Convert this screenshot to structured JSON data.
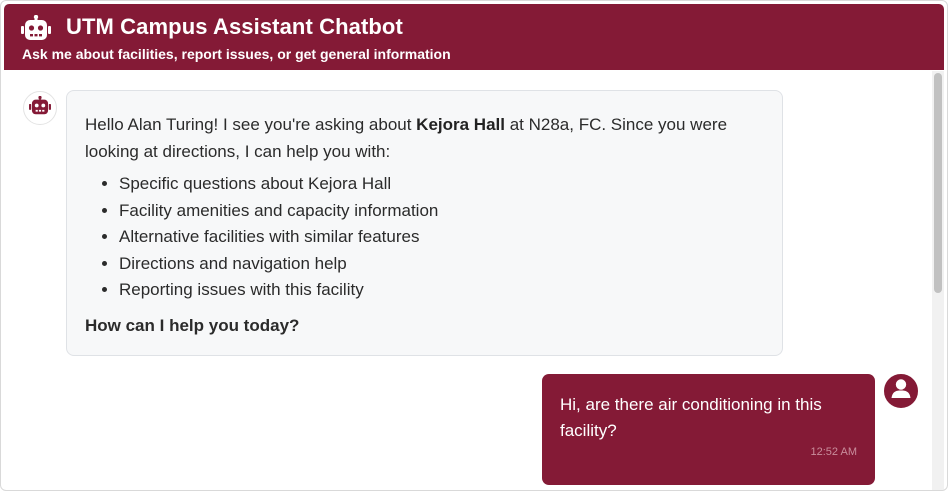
{
  "header": {
    "title": "UTM Campus Assistant Chatbot",
    "subtitle": "Ask me about facilities, report issues, or get general information",
    "icon": "robot-icon"
  },
  "colors": {
    "brand": "#841a36",
    "bot_bubble_bg": "#f7f8f9"
  },
  "messages": {
    "bot": {
      "avatar_icon": "robot-icon",
      "intro_prefix": "Hello Alan Turing! I see you're asking about ",
      "facility_name": "Kejora Hall",
      "intro_suffix": " at N28a, FC. Since you were looking at directions, I can help you with:",
      "options": [
        "Specific questions about Kejora Hall",
        "Facility amenities and capacity information",
        "Alternative facilities with similar features",
        "Directions and navigation help",
        "Reporting issues with this facility"
      ],
      "question": "How can I help you today?"
    },
    "user": {
      "avatar_icon": "user-icon",
      "text": "Hi, are there air conditioning in this facility?",
      "time": "12:52 AM"
    }
  }
}
